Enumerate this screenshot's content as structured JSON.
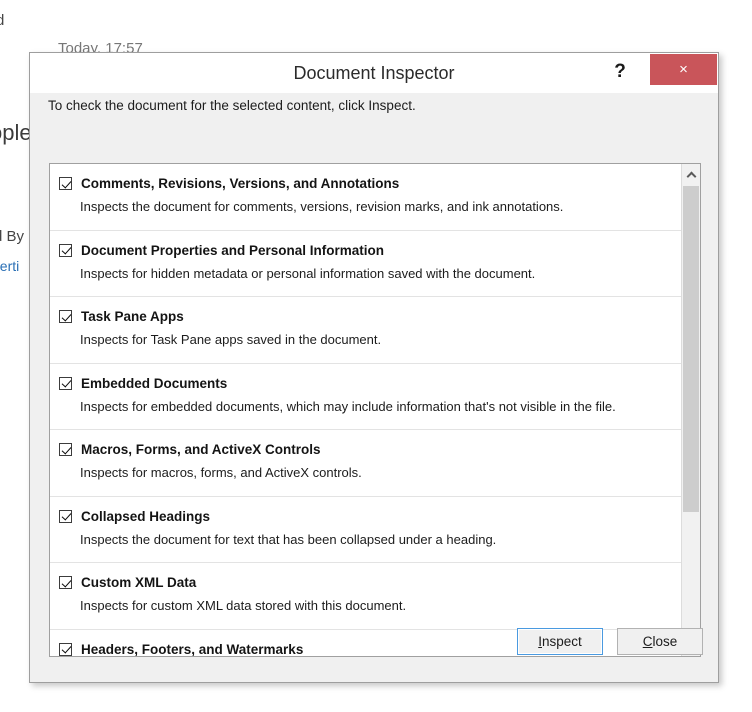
{
  "background": {
    "fragments": [
      {
        "id": "d",
        "text": "d"
      },
      {
        "id": "today",
        "text": "Today, 17:57"
      },
      {
        "id": "people",
        "text": "ople"
      },
      {
        "id": "by",
        "text": "d By"
      },
      {
        "id": "properties_link",
        "text": "perti"
      }
    ]
  },
  "dialog": {
    "title": "Document Inspector",
    "help_label": "?",
    "close_label": "×",
    "instruction": "To check the document for the selected content, click Inspect.",
    "items": [
      {
        "checked": true,
        "title": "Comments, Revisions, Versions, and Annotations",
        "desc": "Inspects the document for comments, versions, revision marks, and ink annotations."
      },
      {
        "checked": true,
        "title": "Document Properties and Personal Information",
        "desc": "Inspects for hidden metadata or personal information saved with the document."
      },
      {
        "checked": true,
        "title": "Task Pane Apps",
        "desc": "Inspects for Task Pane apps saved in the document."
      },
      {
        "checked": true,
        "title": "Embedded Documents",
        "desc": "Inspects for embedded documents, which may include information that's not visible in the file."
      },
      {
        "checked": true,
        "title": "Macros, Forms, and ActiveX Controls",
        "desc": "Inspects for macros, forms, and ActiveX controls."
      },
      {
        "checked": true,
        "title": "Collapsed Headings",
        "desc": "Inspects the document for text that has been collapsed under a heading."
      },
      {
        "checked": true,
        "title": "Custom XML Data",
        "desc": "Inspects for custom XML data stored with this document."
      },
      {
        "checked": true,
        "title": "Headers, Footers, and Watermarks",
        "desc": ""
      }
    ],
    "buttons": {
      "inspect": {
        "prefix": "",
        "accel": "I",
        "suffix": "nspect"
      },
      "close": {
        "prefix": "",
        "accel": "C",
        "suffix": "lose"
      }
    }
  },
  "colors": {
    "close_button_red": "#c9555a",
    "dialog_face": "#f0f0f0",
    "focus_border": "#4a9ae0",
    "link_blue": "#2a6fb5"
  }
}
